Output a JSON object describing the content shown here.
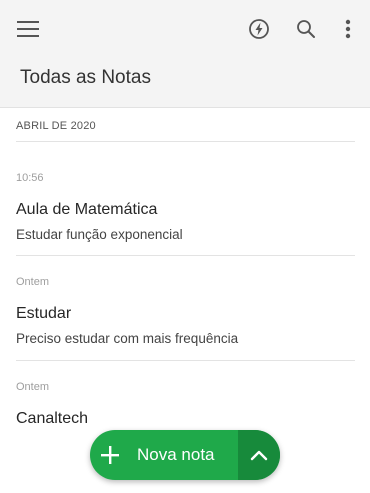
{
  "header": {
    "title": "Todas as Notas",
    "icons": [
      "menu-icon",
      "lightning-icon",
      "search-icon",
      "more-vert-icon"
    ]
  },
  "list": {
    "month": "ABRIL DE 2020",
    "notes": [
      {
        "time": "10:56",
        "title": "Aula de Matemática",
        "snippet": "Estudar função exponencial"
      },
      {
        "time": "Ontem",
        "title": "Estudar",
        "snippet": "Preciso estudar com mais frequência"
      },
      {
        "time": "Ontem",
        "title": "Canaltech",
        "snippet": ""
      }
    ]
  },
  "fab": {
    "label": "Nova nota",
    "icons": [
      "plus-icon",
      "chevron-up-icon"
    ]
  },
  "colors": {
    "accent": "#1fa94a",
    "accent_dark": "#178a3b",
    "toolbar_bg": "#f4f4f4"
  }
}
